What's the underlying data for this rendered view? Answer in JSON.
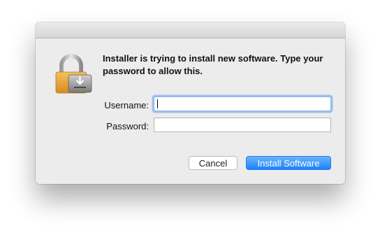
{
  "dialog": {
    "message": "Installer is trying to install new software. Type your password to allow this.",
    "username_label": "Username:",
    "password_label": "Password:",
    "username_value": "",
    "password_value": "",
    "cancel_label": "Cancel",
    "install_label": "Install Software",
    "icon": "lock-with-installer-icon"
  },
  "colors": {
    "dialog_bg": "#ececec",
    "default_button": "#1a82fb",
    "focus_ring": "#9dc0f2",
    "lock_body": "#e8a033"
  }
}
